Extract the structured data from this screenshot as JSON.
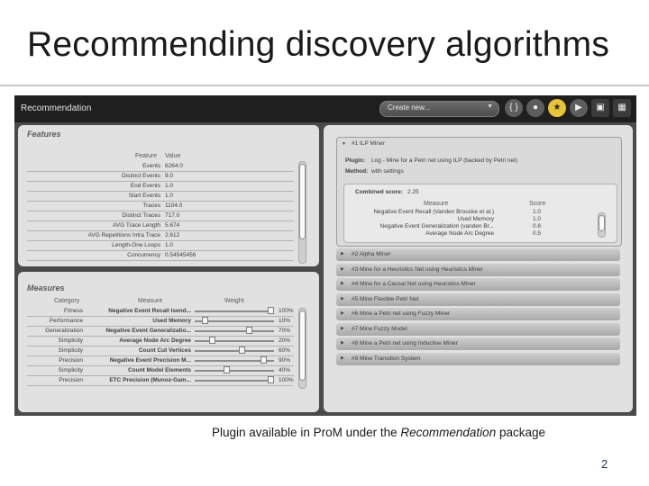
{
  "slide": {
    "title": "Recommending discovery algorithms",
    "caption_prefix": "Plugin available in ProM under the ",
    "caption_emphasis": "Recommendation",
    "caption_suffix": " package",
    "page_number": "2"
  },
  "app": {
    "title": "Recommendation",
    "view_select": {
      "value": "Create new..."
    },
    "toolbar": [
      {
        "icon": "braces-icon",
        "glyph": "{ }"
      },
      {
        "icon": "drop-icon",
        "glyph": "●"
      },
      {
        "icon": "star-icon",
        "glyph": "★"
      },
      {
        "icon": "play-icon",
        "glyph": "▶"
      },
      {
        "icon": "export-icon",
        "glyph": "▣"
      },
      {
        "icon": "grid-icon",
        "glyph": "▦"
      }
    ],
    "colors": {
      "header": "#1f1f1f",
      "background": "#4a4a4a",
      "panel": "#e1e1e1",
      "highlight": "#e9c43a"
    }
  },
  "features": {
    "title": "Features",
    "headers": {
      "feature": "Feature",
      "value": "Value"
    },
    "rows": [
      {
        "feature": "Events",
        "value": "6264.0"
      },
      {
        "feature": "Distinct Events",
        "value": "9.0"
      },
      {
        "feature": "End Events",
        "value": "1.0"
      },
      {
        "feature": "Start Events",
        "value": "1.0"
      },
      {
        "feature": "Traces",
        "value": "1104.0"
      },
      {
        "feature": "Distinct Traces",
        "value": "717.0"
      },
      {
        "feature": "AVG Trace Length",
        "value": "5.674"
      },
      {
        "feature": "AVG Repetitions Intra Trace",
        "value": "2.612"
      },
      {
        "feature": "Length-One Loops",
        "value": "1.0"
      },
      {
        "feature": "Concurrency",
        "value": "0.54545456"
      }
    ]
  },
  "measures": {
    "title": "Measures",
    "headers": {
      "category": "Category",
      "measure": "Measure",
      "weight": "Weight"
    },
    "rows": [
      {
        "category": "Fitness",
        "measure": "Negative Event Recall Isend...",
        "weight_pct": "100%",
        "level": 1.0
      },
      {
        "category": "Performance",
        "measure": "Used Memory",
        "weight_pct": "10%",
        "level": 0.1
      },
      {
        "category": "Generalization",
        "measure": "Negative Event Generalizatio...",
        "weight_pct": "70%",
        "level": 0.7
      },
      {
        "category": "Simplicity",
        "measure": "Average Node Arc Degree",
        "weight_pct": "20%",
        "level": 0.2
      },
      {
        "category": "Simplicity",
        "measure": "Count Cut Vertices",
        "weight_pct": "60%",
        "level": 0.6
      },
      {
        "category": "Precision",
        "measure": "Negative Event Precision M...",
        "weight_pct": "90%",
        "level": 0.9
      },
      {
        "category": "Simplicity",
        "measure": "Count Model Elements",
        "weight_pct": "40%",
        "level": 0.4
      },
      {
        "category": "Precision",
        "measure": "ETC Precision (Munoz-Gam...",
        "weight_pct": "100%",
        "level": 1.0
      }
    ]
  },
  "recommendations": {
    "expanded": {
      "label": "#1 ILP Miner",
      "plugin_label": "Plugin:",
      "plugin_value": "Log - Mine for a Petri net using ILP (backed by Petri net)",
      "method_label": "Method:",
      "method_value": "with settings",
      "combined_label": "Combined score:",
      "combined_value": "2.25",
      "score_headers": {
        "measure": "Measure",
        "score": "Score"
      },
      "scores": [
        {
          "measure": "Negative Event Recall (Vanden Broucke et al.)",
          "score": "1.0"
        },
        {
          "measure": "Used Memory",
          "score": "1.0"
        },
        {
          "measure": "Negative Event Generalization (vanden Br...",
          "score": "0.8"
        },
        {
          "measure": "Average Node Arc Degree",
          "score": "0.5"
        }
      ]
    },
    "items": [
      "#2 Alpha Miner",
      "#3 Mine for a Heuristics Net using Heuristics Miner",
      "#4 Mine for a Causal Net using Heuristics Miner",
      "#5 Mine Flexible Petri Net",
      "#6 Mine a Petri net using Fuzzy Miner",
      "#7 Mine Fuzzy Model",
      "#8 Mine a Petri net using Inductive Miner",
      "#9 Mine Transition System"
    ]
  }
}
